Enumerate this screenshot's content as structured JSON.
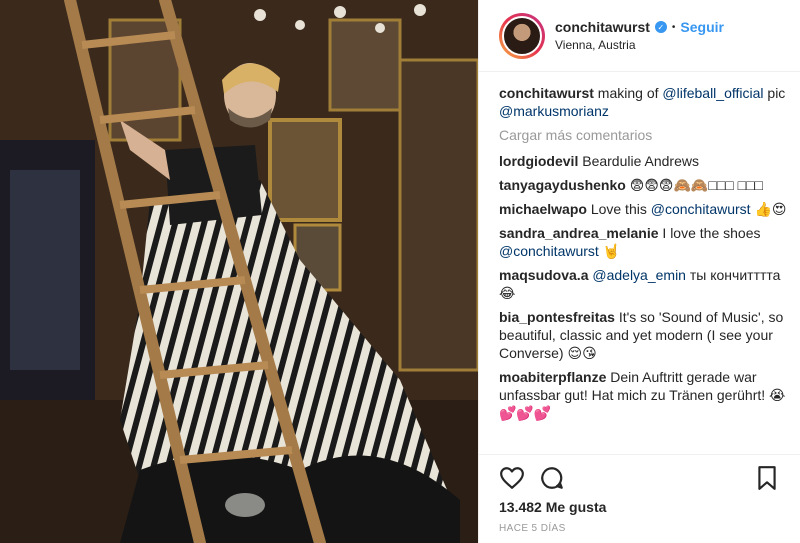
{
  "post": {
    "username": "conchitawurst",
    "verified": true,
    "follow_label": "Seguir",
    "location": "Vienna, Austria",
    "caption_user": "conchitawurst",
    "caption_text_1": "making of",
    "caption_mention_1": "@lifeball_official",
    "caption_text_2": "pic",
    "caption_mention_2": "@markusmorianz",
    "load_more": "Cargar más comentarios",
    "likes": "13.482 Me gusta",
    "time": "HACE 5 DÍAS"
  },
  "comments": [
    {
      "user": "lordgiodevil",
      "text": "Beardulie Andrews"
    },
    {
      "user": "tanyagaydushenko",
      "text": "😨😨😨🙈🙈□□□ □□□"
    },
    {
      "user": "michaelwapo",
      "pre": "Love this",
      "mention": "@conchitawurst",
      "post": "👍😍"
    },
    {
      "user": "sandra_andrea_melanie",
      "pre": "I love the shoes",
      "mention": "@conchitawurst",
      "post": "🤘"
    },
    {
      "user": "maqsudova.a",
      "mention": "@adelya_emin",
      "post": "ты кончитттта😂"
    },
    {
      "user": "bia_pontesfreitas",
      "text": "It's so 'Sound of Music', so beautiful, classic and yet modern (I see your Converse) 😌😘"
    },
    {
      "user": "moabiterpflanze",
      "text": "Dein Auftritt gerade war unfassbar gut! Hat mich zu Tränen gerührt! 😭💕💕💕"
    }
  ],
  "icons": {
    "heart": "heart-icon",
    "comment": "comment-icon",
    "bookmark": "bookmark-icon",
    "verified": "verified-badge-icon"
  },
  "colors": {
    "link": "#3897f0",
    "mention": "#003569",
    "muted": "#999999"
  }
}
